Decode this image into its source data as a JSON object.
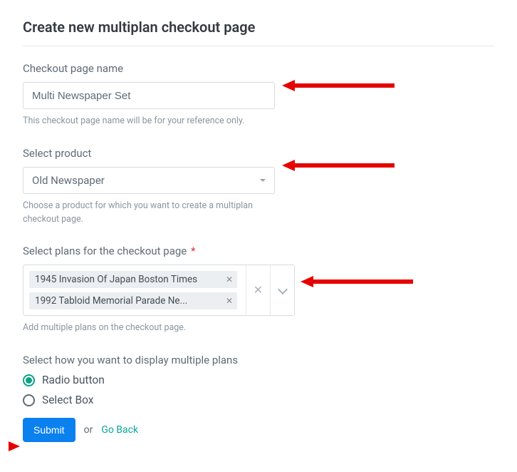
{
  "title": "Create new multiplan checkout page",
  "name_field": {
    "label": "Checkout page name",
    "value": "Multi Newspaper Set",
    "helper": "This checkout page name will be for your reference only."
  },
  "product_field": {
    "label": "Select product",
    "value": "Old Newspaper",
    "helper": "Choose a product for which you want to create a multiplan checkout page."
  },
  "plans_field": {
    "label": "Select plans for the checkout page",
    "required_mark": "*",
    "tags": [
      "1945 Invasion Of Japan Boston Times",
      "1992 Tabloid Memorial Parade Ne..."
    ],
    "helper": "Add multiple plans on the checkout page."
  },
  "display_field": {
    "label": "Select how you want to display multiple plans",
    "options": [
      {
        "label": "Radio button",
        "checked": true
      },
      {
        "label": "Select Box",
        "checked": false
      }
    ]
  },
  "actions": {
    "submit": "Submit",
    "or": "or",
    "go_back": "Go Back"
  }
}
